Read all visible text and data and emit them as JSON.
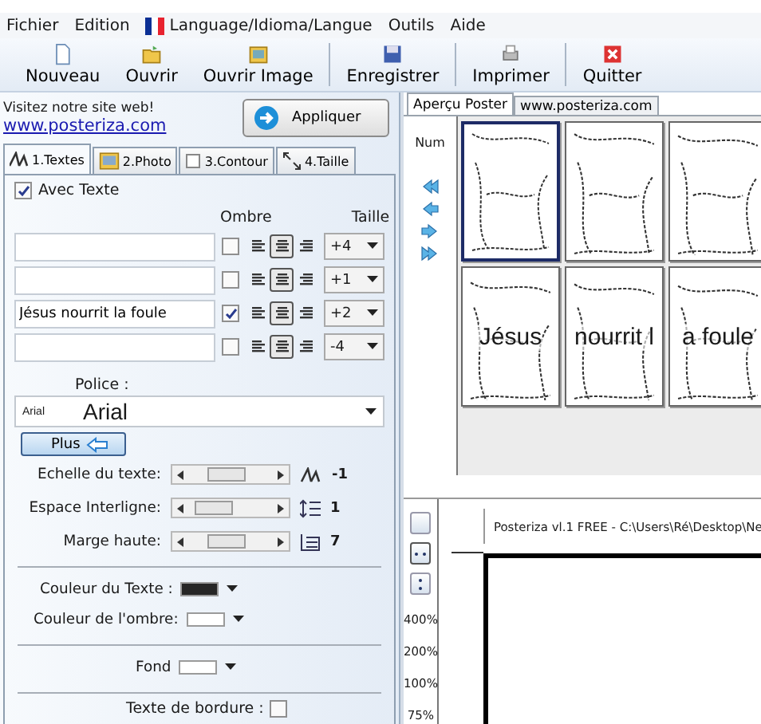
{
  "menu": [
    {
      "label": "Fichier",
      "kind": "plain"
    },
    {
      "label": "Edition",
      "kind": "plain"
    },
    {
      "label": "Language/Idioma/Langue",
      "kind": "language"
    },
    {
      "label": "Outils",
      "kind": "plain"
    },
    {
      "label": "Aide",
      "kind": "plain"
    }
  ],
  "toolbar": [
    [
      "Nouveau",
      "Ouvrir",
      "Ouvrir Image"
    ],
    [
      "Enregistrer"
    ],
    [
      "Imprimer"
    ],
    [
      "Quitter"
    ]
  ],
  "website": {
    "caption": "Visitez notre site web!",
    "link": "www.posteriza.com"
  },
  "apply_button": "Appliquer",
  "left_tabs": [
    {
      "label": "1.Textes",
      "selected": true
    },
    {
      "label": "2.Photo",
      "selected": false
    },
    {
      "label": "3.Contour",
      "selected": false
    },
    {
      "label": "4.Taille",
      "selected": false
    }
  ],
  "with_text": {
    "label": "Avec Texte",
    "checked": true
  },
  "columns": {
    "shadow": "Ombre",
    "size": "Taille"
  },
  "text_lines": [
    {
      "shadow": false,
      "align": [
        {
          "selected": false
        },
        {
          "selected": true
        },
        {
          "selected": false
        }
      ],
      "size": "+4"
    },
    {
      "shadow": false,
      "align": [
        {
          "selected": false
        },
        {
          "selected": true
        },
        {
          "selected": false
        }
      ],
      "size": "+1"
    },
    {
      "value": "Jésus nourrit la foule",
      "shadow": true,
      "align": [
        {
          "selected": false
        },
        {
          "selected": true
        },
        {
          "selected": false
        }
      ],
      "size": "+2"
    },
    {
      "shadow": false,
      "align": [
        {
          "selected": false
        },
        {
          "selected": true
        },
        {
          "selected": false
        }
      ],
      "size": "-4"
    }
  ],
  "font": {
    "label": "Police :",
    "small": "Arial",
    "large": "Arial"
  },
  "more_button": "Plus",
  "sliders": [
    {
      "label": "Echelle du texte:",
      "level": 0.45,
      "value": "-1"
    },
    {
      "label": "Espace Interligne:",
      "level": 0.3,
      "value": "1"
    },
    {
      "label": "Marge haute:",
      "level": 0.45,
      "value": "7"
    }
  ],
  "colors": [
    {
      "label": "Couleur du Texte :",
      "color": "#262626"
    },
    {
      "label": "Couleur de l'ombre:",
      "color": "#ffffff"
    },
    {
      "label": "Fond",
      "color": "#ffffff"
    }
  ],
  "border_text": {
    "label": "Texte de bordure :",
    "checked": false
  },
  "right_tabs": [
    {
      "label": "Aperçu Poster",
      "selected": true
    },
    {
      "label": "www.posteriza.com",
      "selected": false
    }
  ],
  "num_label": "Num",
  "tiles": [
    {
      "selected": true
    },
    {
      "selected": false
    },
    {
      "selected": false
    },
    {
      "text": "Jésus",
      "selected": false
    },
    {
      "text": "nourrit l",
      "selected": false
    },
    {
      "text": "a foule",
      "selected": false
    }
  ],
  "zoom_levels": [
    "400%",
    "200%",
    "100%",
    "75%"
  ],
  "preview_title": "Posteriza vl.1 FREE - C:\\Users\\Ré\\Desktop\\Ne"
}
